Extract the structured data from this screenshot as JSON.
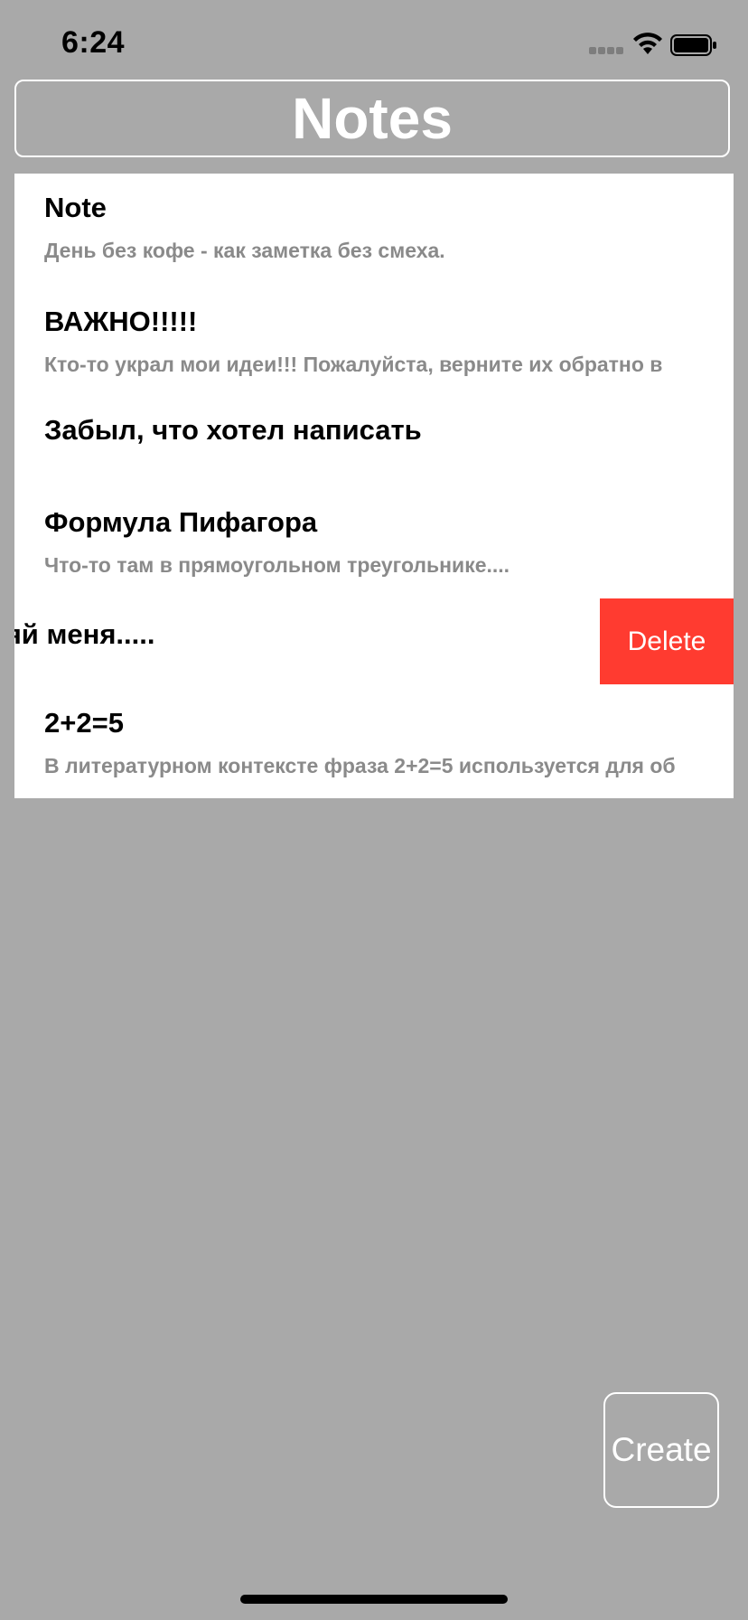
{
  "status_bar": {
    "time": "6:24",
    "icons": [
      "signal-icon",
      "wifi-icon",
      "battery-icon"
    ]
  },
  "header": {
    "title": "Notes"
  },
  "notes": [
    {
      "title": "Note",
      "body": "День без кофе - как заметка без смеха."
    },
    {
      "title": "ВАЖНО!!!!!",
      "body": "Кто-то украл мои идеи!!! Пожалуйста, верните их обратно в"
    },
    {
      "title": "Забыл, что хотел написать",
      "body": ""
    },
    {
      "title": "Формула Пифагора",
      "body": "Что-то там в прямоугольном треугольнике...."
    },
    {
      "title": "ляй меня.....",
      "body": "",
      "swipe_action": "Delete"
    },
    {
      "title": "2+2=5",
      "body": "В литературном контексте фраза 2+2=5 используется для об"
    }
  ],
  "create_button": {
    "label": "Create"
  },
  "colors": {
    "background": "#a9a9a9",
    "delete": "#ff3b30",
    "list_background": "#ffffff",
    "secondary_text": "#8a8a8a"
  }
}
